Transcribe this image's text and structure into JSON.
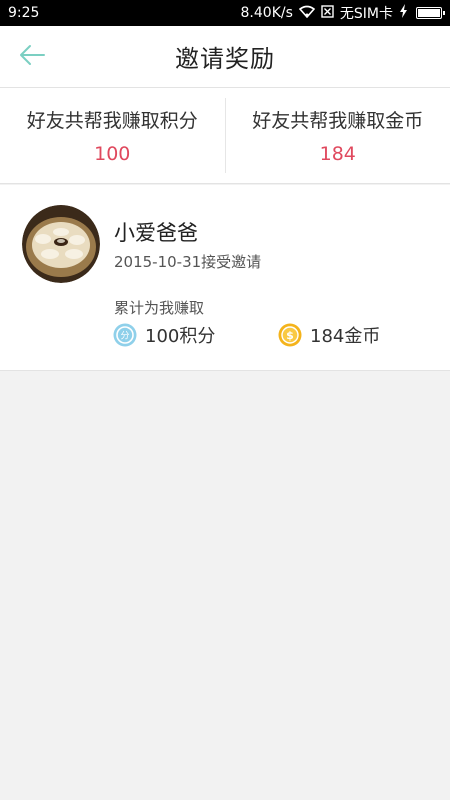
{
  "status_bar": {
    "time": "9:25",
    "speed": "8.40K/s",
    "sim_status": "无SIM卡",
    "icons": [
      "wifi-icon",
      "no-sim-icon",
      "charging-icon",
      "battery-icon"
    ]
  },
  "header": {
    "title": "邀请奖励",
    "back_icon": "arrow-left-icon",
    "accent_color": "#7bcfc2"
  },
  "stats": [
    {
      "label": "好友共帮我赚取积分",
      "value": "100"
    },
    {
      "label": "好友共帮我赚取金币",
      "value": "184"
    }
  ],
  "invite": {
    "name": "小爱爸爸",
    "date_text": "2015-10-31接受邀请",
    "earned_label": "累计为我赚取",
    "points": {
      "icon": "points-icon",
      "text": "100积分",
      "color": "#7ec9e8"
    },
    "coins": {
      "icon": "gold-coin-icon",
      "text": "184金币",
      "color": "#f4b31b"
    }
  }
}
